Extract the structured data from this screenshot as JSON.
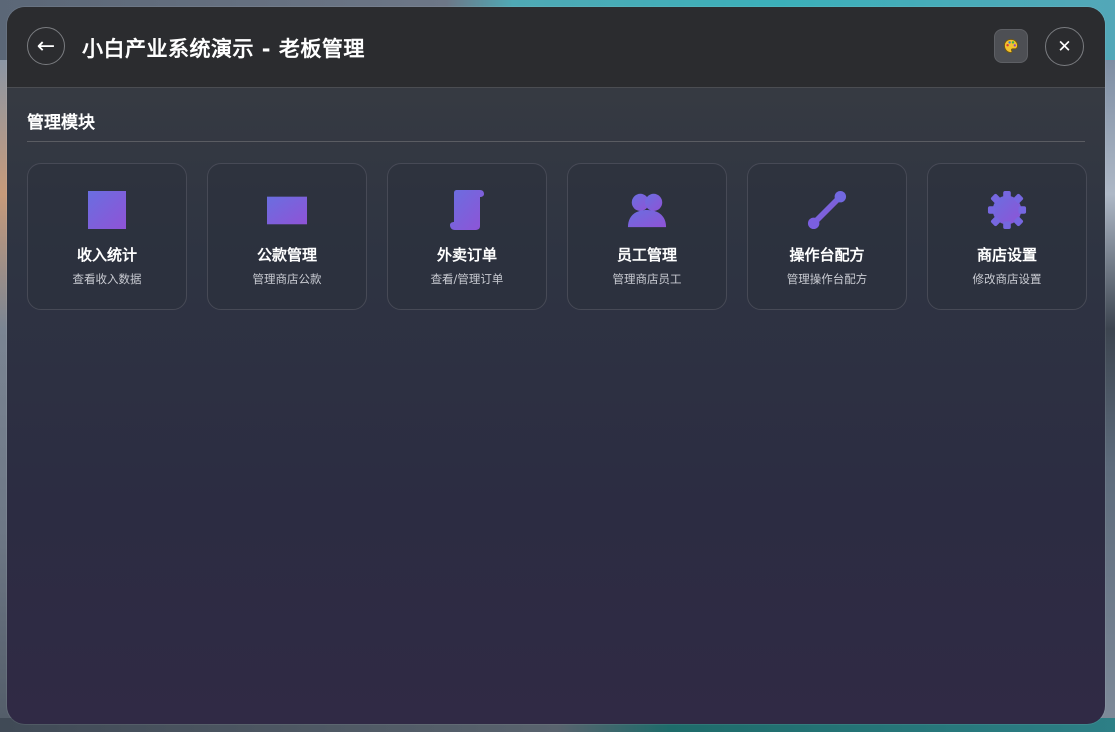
{
  "window": {
    "title": "小白产业系统演示 - 老板管理",
    "back_symbol": "←",
    "close_symbol": "✕",
    "theme_icon": "palette-icon"
  },
  "section": {
    "title": "管理模块"
  },
  "colors": {
    "icon_gradient_start": "#6a6ee0",
    "icon_gradient_end": "#8f53d6",
    "accent": "#7b5fe0"
  },
  "modules": [
    {
      "label": "收入统计",
      "desc": "查看收入数据",
      "icon": "chart-square-icon"
    },
    {
      "label": "公款管理",
      "desc": "管理商店公款",
      "icon": "money-rectangle-icon"
    },
    {
      "label": "外卖订单",
      "desc": "查看/管理订单",
      "icon": "scroll-icon"
    },
    {
      "label": "员工管理",
      "desc": "管理商店员工",
      "icon": "users-icon"
    },
    {
      "label": "操作台配方",
      "desc": "管理操作台配方",
      "icon": "bone-icon"
    },
    {
      "label": "商店设置",
      "desc": "修改商店设置",
      "icon": "cog-icon"
    }
  ]
}
